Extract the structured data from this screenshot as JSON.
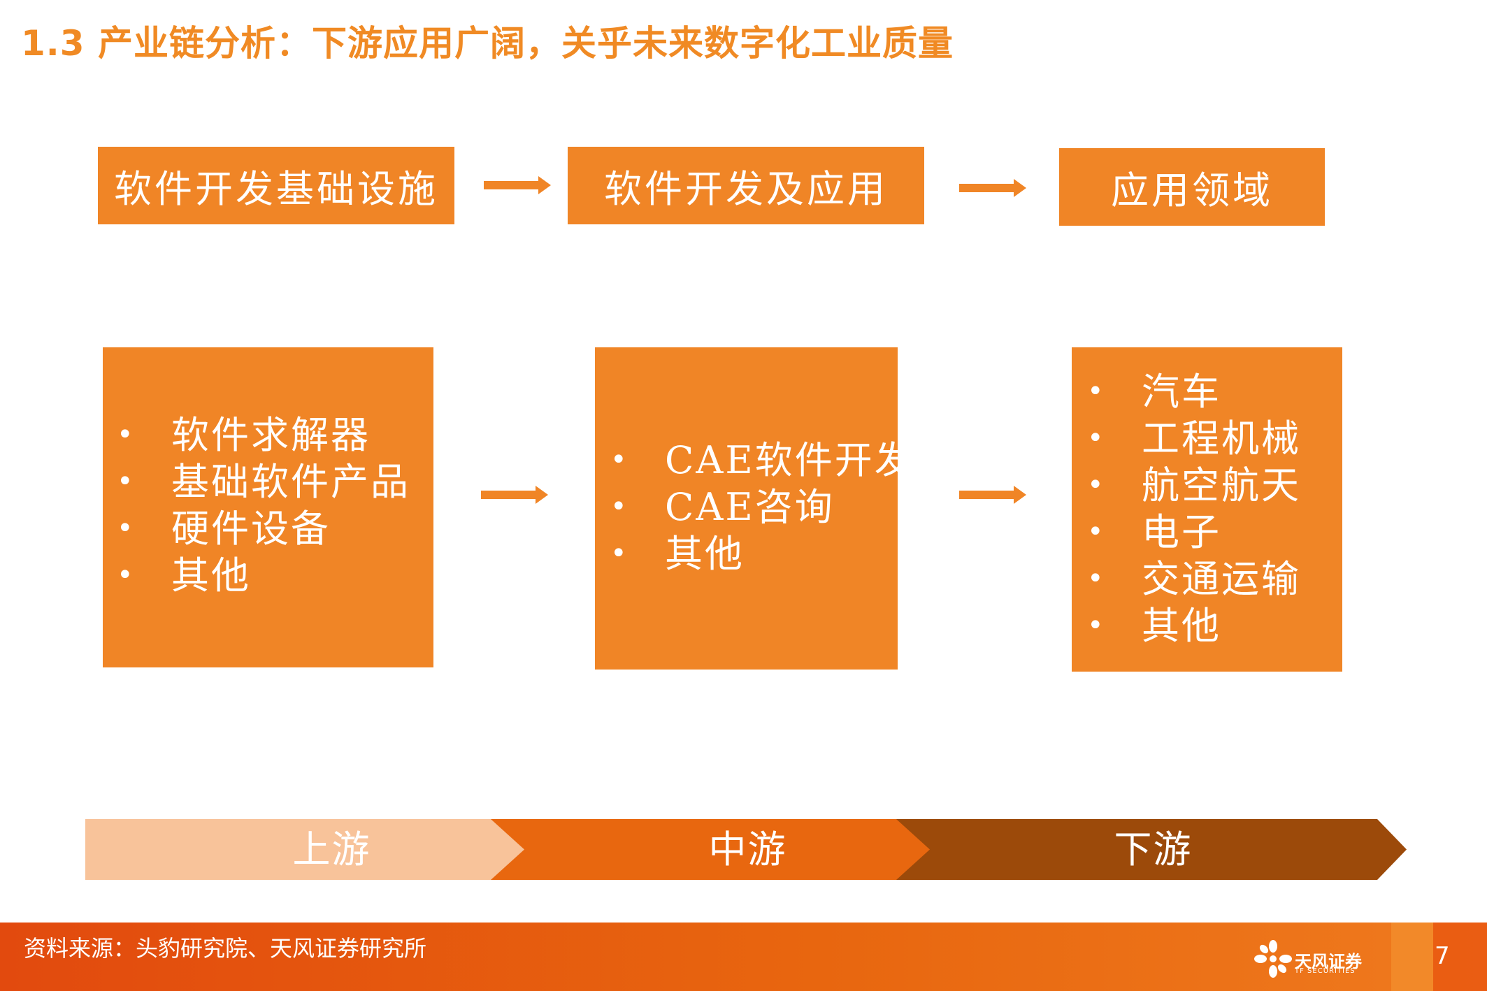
{
  "title": "1.3 产业链分析：下游应用广阔，关乎未来数字化工业质量",
  "stages": [
    {
      "header": "软件开发基础设施",
      "items": [
        "软件求解器",
        "基础软件产品",
        "硬件设备",
        "其他"
      ]
    },
    {
      "header": "软件开发及应用",
      "items": [
        "CAE软件开发",
        "CAE咨询",
        "其他"
      ]
    },
    {
      "header": "应用领域",
      "items": [
        "汽车",
        "工程机械",
        "航空航天",
        "电子",
        "交通运输",
        "其他"
      ]
    }
  ],
  "bullet": "•",
  "flow": [
    "上游",
    "中游",
    "下游"
  ],
  "colors": {
    "accent": "#f08526",
    "title": "#f08a24",
    "upstream": "#f8c39a",
    "midstream": "#e8670f",
    "downstream": "#9c4a0a"
  },
  "footer": {
    "source": "资料来源：头豹研究院、天风证券研究所",
    "logo_text": "天风证券",
    "logo_sub": "TF SECURITIES",
    "page": "7"
  }
}
